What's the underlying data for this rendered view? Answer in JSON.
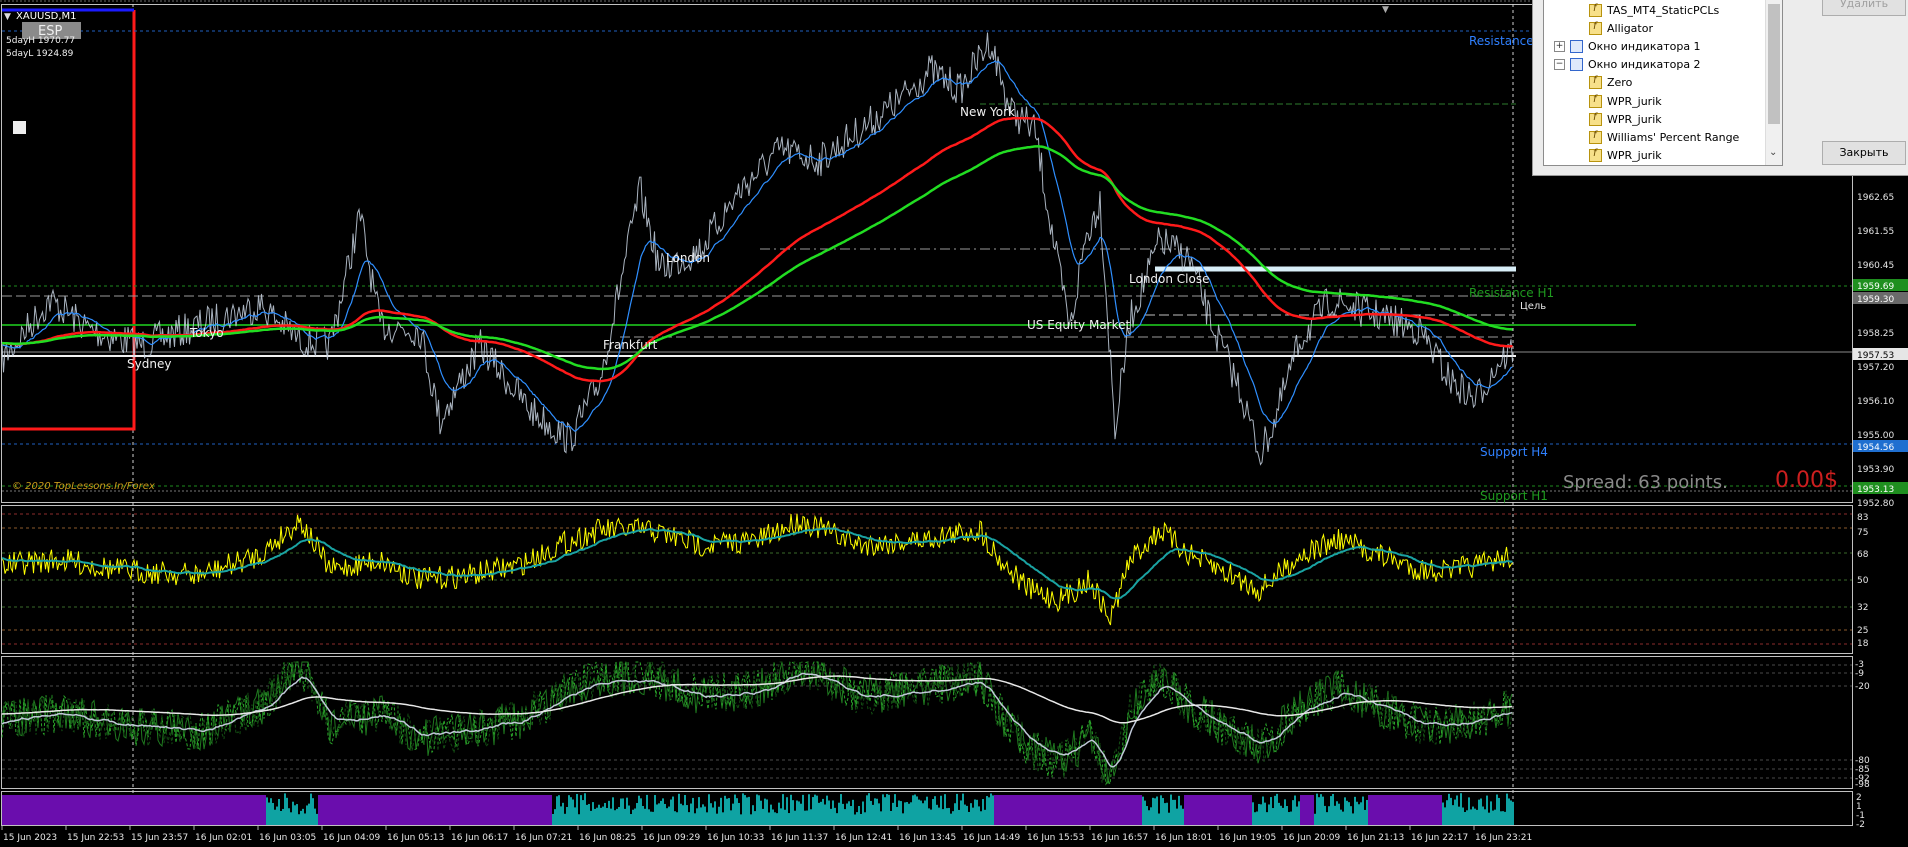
{
  "symbol": {
    "name": "XAUUSD,M1",
    "tag": "ESP"
  },
  "levels_info": {
    "five_day_high": "5dayH 1970.77",
    "five_day_low": "5dayL 1924.89"
  },
  "copyright": "© 2020 TopLessons.In/Forex",
  "sessions": [
    "Tokyo",
    "Sydney",
    "Frankfurt",
    "London",
    "New York",
    "US Equity Market",
    "London Close"
  ],
  "level_labels": {
    "resistance_h4": "Resistance",
    "resistance_h1": "Resistance H1",
    "target": "Цель",
    "support_h4": "Support H4",
    "support_h1": "Support H1"
  },
  "spread": {
    "text": "Spread: 63 points.",
    "pl": "0.00$"
  },
  "price_axis": [
    "1962.65",
    "1961.55",
    "1960.45",
    "1959.69",
    "1959.30",
    "1958.25",
    "1957.53",
    "1957.20",
    "1956.10",
    "1955.00",
    "1954.56",
    "1953.90",
    "1953.13",
    "1952.80"
  ],
  "wpr_axis": [
    "83",
    "75",
    "68",
    "50",
    "32",
    "25",
    "18"
  ],
  "osc_axis": [
    "-3",
    "-9",
    "-20",
    "-80",
    "-85",
    "-92",
    "-98"
  ],
  "hist_axis": [
    "2",
    "1",
    "-1",
    "-2"
  ],
  "time_axis": [
    "15 Jun 2023",
    "15 Jun 22:53",
    "15 Jun 23:57",
    "16 Jun 02:01",
    "16 Jun 03:05",
    "16 Jun 04:09",
    "16 Jun 05:13",
    "16 Jun 06:17",
    "16 Jun 07:21",
    "16 Jun 08:25",
    "16 Jun 09:29",
    "16 Jun 10:33",
    "16 Jun 11:37",
    "16 Jun 12:41",
    "16 Jun 13:45",
    "16 Jun 14:49",
    "16 Jun 15:53",
    "16 Jun 16:57",
    "16 Jun 18:01",
    "16 Jun 19:05",
    "16 Jun 20:09",
    "16 Jun 21:13",
    "16 Jun 22:17",
    "16 Jun 23:21"
  ],
  "indicator_tree": [
    {
      "label": "TAS_MT4_StaticPCLs",
      "type": "indicator",
      "level": 2
    },
    {
      "label": "Alligator",
      "type": "indicator",
      "level": 2
    },
    {
      "label": "Окно индикатора 1",
      "type": "window",
      "level": 1,
      "expander": "+"
    },
    {
      "label": "Окно индикатора 2",
      "type": "window",
      "level": 1,
      "expander": "−"
    },
    {
      "label": "Zero",
      "type": "indicator",
      "level": 2
    },
    {
      "label": "WPR_jurik",
      "type": "indicator",
      "level": 2
    },
    {
      "label": "WPR_jurik",
      "type": "indicator",
      "level": 2
    },
    {
      "label": "Williams' Percent Range",
      "type": "indicator",
      "level": 2
    },
    {
      "label": "WPR_jurik",
      "type": "indicator",
      "level": 2
    }
  ],
  "buttons": {
    "delete": "Удалить",
    "close": "Закрыть"
  },
  "colors": {
    "price_line": "#c7d2e0",
    "ma_red": "#ff1a1a",
    "ma_green": "#22dd22",
    "jurik_blue": "#2f8fff",
    "wpr_yellow": "#ffff00",
    "wpr_teal": "#1aa3a3",
    "hist_purple": "#6a0dad",
    "hist_teal": "#0fa3a3"
  }
}
